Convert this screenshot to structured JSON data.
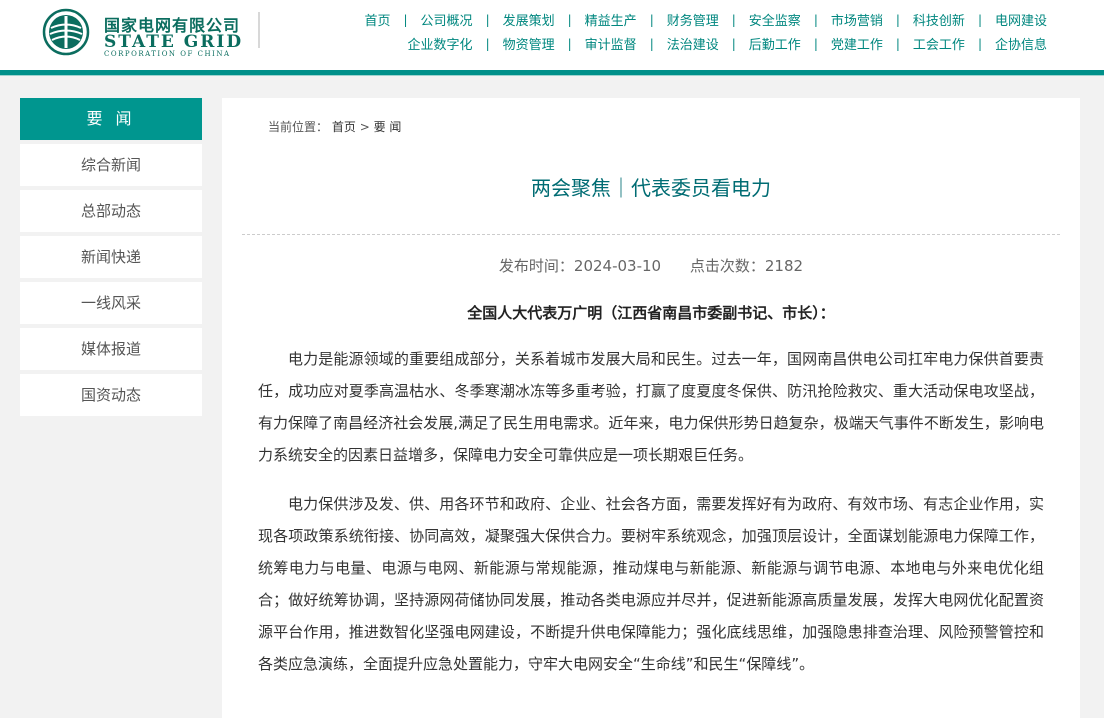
{
  "logo": {
    "cn": "国家电网有限公司",
    "en": "STATE GRID",
    "sub": "CORPORATION OF CHINA",
    "emblem_icon": "state-grid-emblem-icon",
    "brand_color": "#0b6d5f"
  },
  "nav": {
    "row1": [
      "首页",
      "公司概况",
      "发展策划",
      "精益生产",
      "财务管理",
      "安全监察",
      "市场营销",
      "科技创新",
      "电网建设"
    ],
    "row2": [
      "企业数字化",
      "物资管理",
      "审计监督",
      "法治建设",
      "后勤工作",
      "党建工作",
      "工会工作",
      "企协信息"
    ],
    "separator": "|"
  },
  "sidebar": {
    "active": "要 闻",
    "items": [
      "综合新闻",
      "总部动态",
      "新闻快递",
      "一线风采",
      "媒体报道",
      "国资动态"
    ]
  },
  "breadcrumb": {
    "label": "当前位置：",
    "home": "首页",
    "sep": ">",
    "current": "要 闻"
  },
  "article": {
    "title": "两会聚焦｜代表委员看电力",
    "publish_time": "发布时间：2024-03-10",
    "views": "点击次数：2182",
    "subheading": "全国人大代表万广明（江西省南昌市委副书记、市长）：",
    "paragraphs": [
      "电力是能源领域的重要组成部分，关系着城市发展大局和民生。过去一年，国网南昌供电公司扛牢电力保供首要责任，成功应对夏季高温枯水、冬季寒潮冰冻等多重考验，打赢了度夏度冬保供、防汛抢险救灾、重大活动保电攻坚战，有力保障了南昌经济社会发展,满足了民生用电需求。近年来，电力保供形势日趋复杂，极端天气事件不断发生，影响电力系统安全的因素日益增多，保障电力安全可靠供应是一项长期艰巨任务。",
      "电力保供涉及发、供、用各环节和政府、企业、社会各方面，需要发挥好有为政府、有效市场、有志企业作用，实现各项政策系统衔接、协同高效，凝聚强大保供合力。要树牢系统观念，加强顶层设计，全面谋划能源电力保障工作，统筹电力与电量、电源与电网、新能源与常规能源，推动煤电与新能源、新能源与调节电源、本地电与外来电优化组合；做好统筹协调，坚持源网荷储协同发展，推动各类电源应并尽并，促进新能源高质量发展，发挥大电网优化配置资源平台作用，推进数智化坚强电网建设，不断提升供电保障能力；强化底线思维，加强隐患排查治理、风险预警管控和各类应急演练，全面提升应急处置能力，守牢大电网安全“生命线”和民生“保障线”。"
    ]
  },
  "colors": {
    "accent": "#00908a",
    "sidebar_active": "#00968f",
    "title": "#006c73",
    "page_bg": "#f2f2f2"
  }
}
